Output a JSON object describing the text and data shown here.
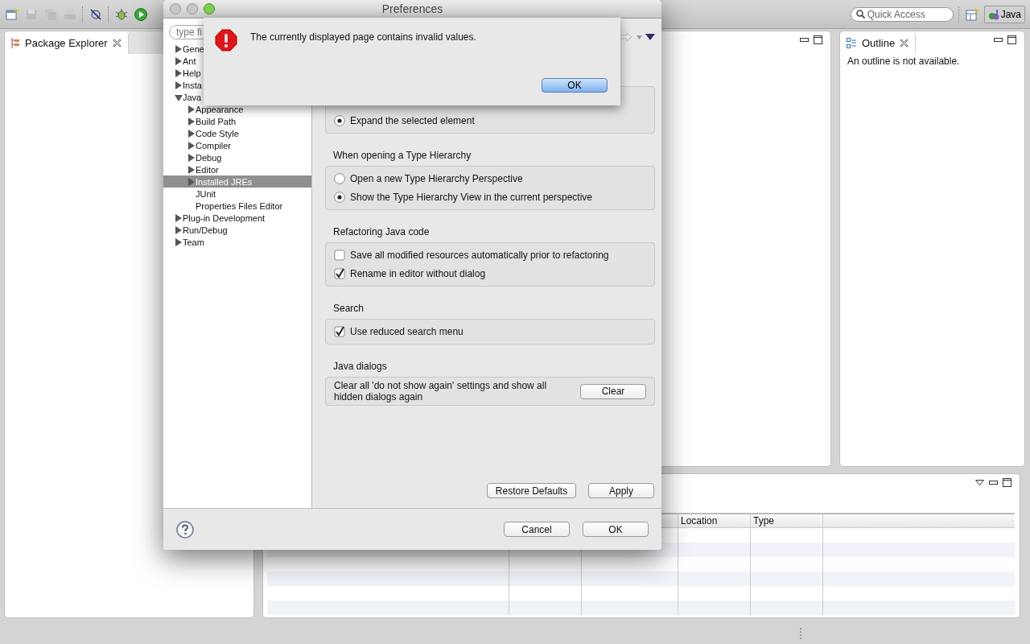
{
  "toolbar": {
    "quick_access": {
      "placeholder": "Quick Access"
    },
    "perspective": "Java"
  },
  "package_explorer": {
    "title": "Package Explorer"
  },
  "outline": {
    "title": "Outline",
    "message": "An outline is not available."
  },
  "bottom_panel": {
    "columns": [
      "Location",
      "Type"
    ]
  },
  "preferences": {
    "title": "Preferences",
    "filter": {
      "placeholder": "type fi"
    },
    "tree": [
      {
        "kind": "folder",
        "label": "Gene",
        "expanded": false,
        "selected": false
      },
      {
        "kind": "folder",
        "label": "Ant",
        "expanded": false,
        "selected": false
      },
      {
        "kind": "folder",
        "label": "Help",
        "expanded": false,
        "selected": false
      },
      {
        "kind": "folder",
        "label": "Insta",
        "expanded": false,
        "selected": false
      },
      {
        "kind": "folder",
        "label": "Java",
        "expanded": true,
        "selected": false,
        "children": [
          {
            "kind": "folder",
            "label": "Appearance",
            "expanded": false,
            "selected": false
          },
          {
            "kind": "folder",
            "label": "Build Path",
            "expanded": false,
            "selected": false
          },
          {
            "kind": "folder",
            "label": "Code Style",
            "expanded": false,
            "selected": false
          },
          {
            "kind": "folder",
            "label": "Compiler",
            "expanded": false,
            "selected": false
          },
          {
            "kind": "folder",
            "label": "Debug",
            "expanded": false,
            "selected": false
          },
          {
            "kind": "folder",
            "label": "Editor",
            "expanded": false,
            "selected": false
          },
          {
            "kind": "folder",
            "label": "Installed JREs",
            "expanded": false,
            "selected": true
          },
          {
            "kind": "page",
            "label": "JUnit",
            "selected": false
          },
          {
            "kind": "page",
            "label": "Properties Files Editor",
            "selected": false
          }
        ]
      },
      {
        "kind": "folder",
        "label": "Plug-in Development",
        "expanded": false,
        "selected": false
      },
      {
        "kind": "folder",
        "label": "Run/Debug",
        "expanded": false,
        "selected": false
      },
      {
        "kind": "folder",
        "label": "Team",
        "expanded": false,
        "selected": false
      }
    ],
    "groups": [
      {
        "kind": "options",
        "options": [
          {
            "kind": "radio",
            "label": "Expand the selected element",
            "checked": true
          }
        ]
      },
      {
        "kind": "options",
        "title": "When opening a Type Hierarchy",
        "options": [
          {
            "kind": "radio",
            "label": "Open a new Type Hierarchy Perspective",
            "checked": false
          },
          {
            "kind": "radio",
            "label": "Show the Type Hierarchy View in the current perspective",
            "checked": true
          }
        ]
      },
      {
        "kind": "options",
        "title": "Refactoring Java code",
        "options": [
          {
            "kind": "checkbox",
            "label": "Save all modified resources automatically prior to refactoring",
            "checked": false
          },
          {
            "kind": "checkbox",
            "label": "Rename in editor without dialog",
            "checked": true
          }
        ]
      },
      {
        "kind": "options",
        "title": "Search",
        "options": [
          {
            "kind": "checkbox",
            "label": "Use reduced search menu",
            "checked": true
          }
        ]
      },
      {
        "kind": "action",
        "title": "Java dialogs",
        "text": "Clear all 'do not show again' settings and show all hidden dialogs again",
        "button": "Clear"
      }
    ],
    "page_buttons": [
      "Restore Defaults",
      "Apply"
    ],
    "dialog_buttons": [
      "Cancel",
      "OK"
    ]
  },
  "alert": {
    "message": "The currently displayed page contains invalid values.",
    "button": "OK"
  }
}
